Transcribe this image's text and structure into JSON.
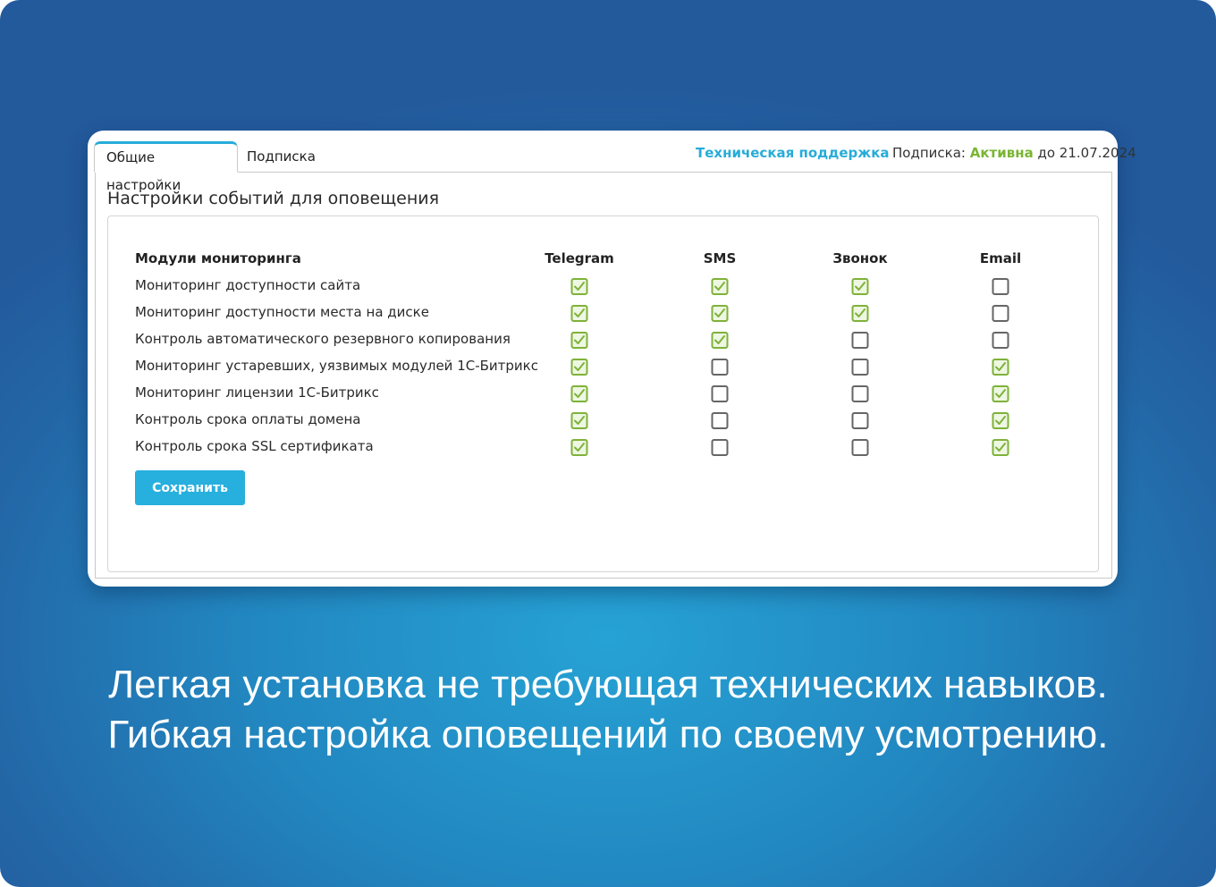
{
  "tabs": [
    {
      "label": "Общие настройки",
      "active": true
    },
    {
      "label": "Подписка",
      "active": false
    }
  ],
  "header": {
    "support_link": "Техническая поддержка",
    "subscription_label": "Подписка:",
    "subscription_status": "Активна",
    "subscription_until": "до 21.07.2024"
  },
  "section_title": "Настройки событий для оповещения",
  "table": {
    "module_header": "Модули мониторинга",
    "channels": [
      "Telegram",
      "SMS",
      "Звонок",
      "Email"
    ],
    "rows": [
      {
        "label": "Мониторинг доступности сайта",
        "checks": [
          true,
          true,
          true,
          false
        ]
      },
      {
        "label": "Мониторинг доступности места на диске",
        "checks": [
          true,
          true,
          true,
          false
        ]
      },
      {
        "label": "Контроль автоматического резервного копирования",
        "checks": [
          true,
          true,
          false,
          false
        ]
      },
      {
        "label": "Мониторинг устаревших, уязвимых модулей 1С-Битрикс",
        "checks": [
          true,
          false,
          false,
          true
        ]
      },
      {
        "label": "Мониторинг лицензии 1С-Битрикс",
        "checks": [
          true,
          false,
          false,
          true
        ]
      },
      {
        "label": "Контроль срока оплаты домена",
        "checks": [
          true,
          false,
          false,
          true
        ]
      },
      {
        "label": "Контроль срока SSL сертификата",
        "checks": [
          true,
          false,
          false,
          true
        ]
      }
    ]
  },
  "save_label": "Сохранить",
  "caption": {
    "line1": "Легкая установка не требующая технических навыков.",
    "line2": "Гибкая настройка оповещений по своему усмотрению."
  },
  "colors": {
    "accent": "#27acd9",
    "active_status": "#7ab532",
    "check_green": "#7fb23a"
  }
}
